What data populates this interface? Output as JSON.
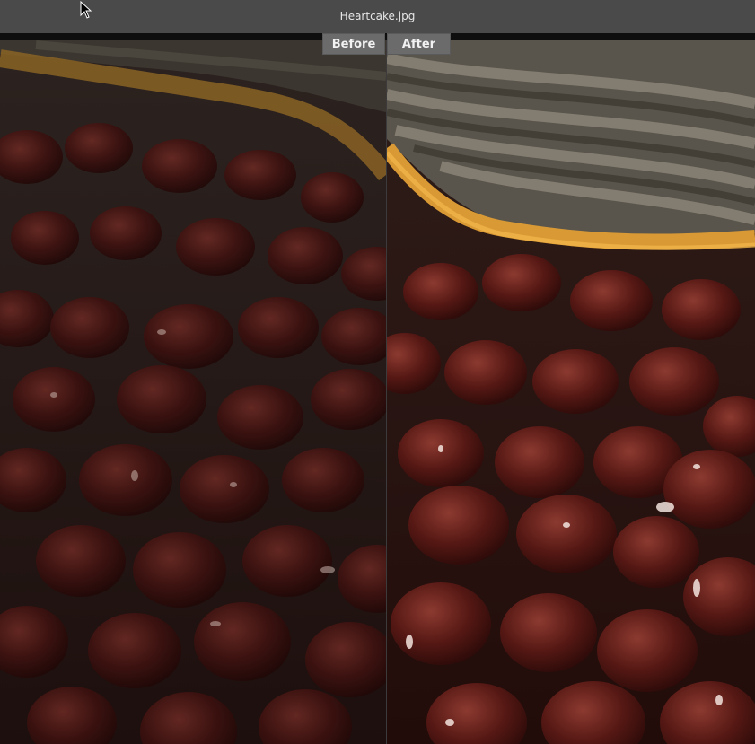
{
  "window": {
    "title": "Heartcake.jpg"
  },
  "compare": {
    "before_label": "Before",
    "after_label": "After",
    "active": "after"
  },
  "image": {
    "subject": "chocolate-covered cherries in a tart",
    "icon": "photo-image"
  },
  "colors": {
    "titlebar": "#4a4a4a",
    "tab": "#6b6b6b",
    "crust": "#d99a35",
    "cherry": "#5a1a16"
  }
}
